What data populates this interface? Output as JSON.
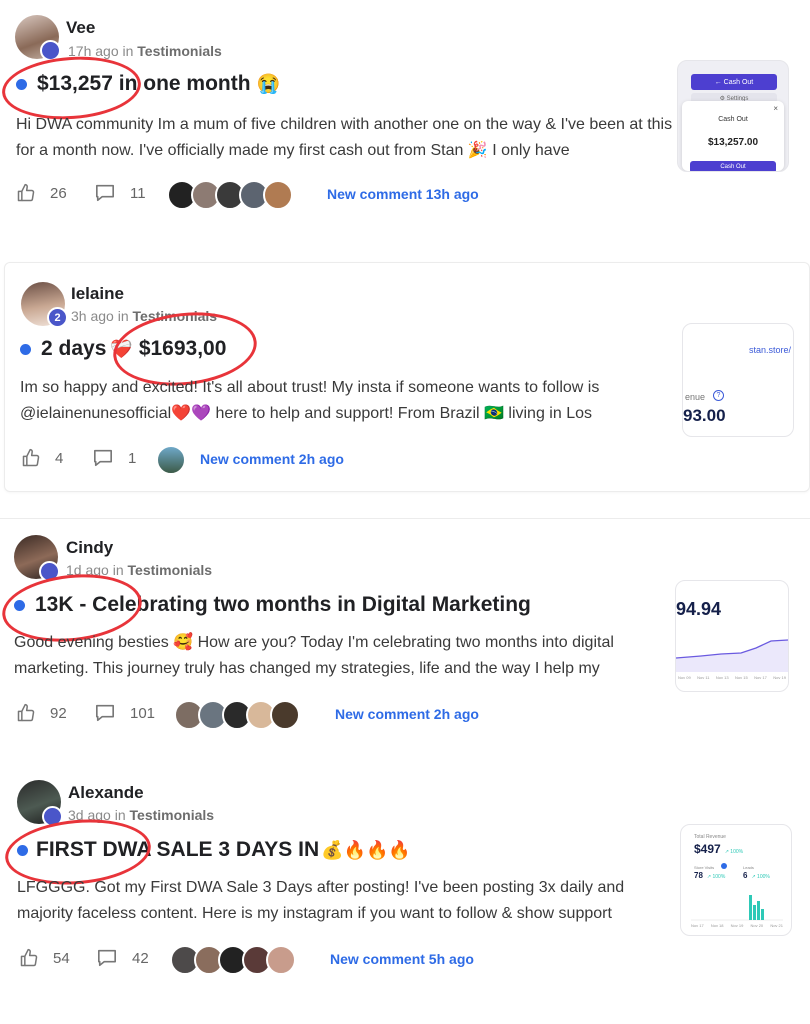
{
  "posts": [
    {
      "author": "Vee",
      "level": "",
      "time": "17h ago",
      "in_word": "in",
      "category": "Testimonials",
      "title_main": "$13,257 in one month",
      "title_emoji": "😭",
      "body": "Hi DWA community Im a mum of five children with another one on the way & I've been at this for a month now. I've officially made my first cash out from Stan 🎉 I only have",
      "likes": "26",
      "comments": "11",
      "new_comment": "New comment 13h ago",
      "preview": {
        "top_button": "← Cash Out",
        "settings": "⚙ Settings",
        "modal_title": "Cash Out",
        "amount": "$13,257.00",
        "bottom_button": "Cash Out"
      }
    },
    {
      "author": "Ielaine",
      "level": "2",
      "time": "3h ago",
      "in_word": "in",
      "category": "Testimonials",
      "title_main": "2 days",
      "title_emoji": "❤️‍🩹",
      "title_amount": "$1693,00",
      "body": "Im so happy and excited! It's all about trust! My insta if someone wants to follow is @ielainenunesofficial❤️💜 here to help and support! From Brazil 🇧🇷 living in Los",
      "likes": "4",
      "comments": "1",
      "new_comment": "New comment 2h ago",
      "preview": {
        "url": "stan.store/",
        "label": "enue",
        "value": "93.00"
      }
    },
    {
      "author": "Cindy",
      "level": "",
      "time": "1d ago",
      "in_word": "in",
      "category": "Testimonials",
      "title_main": "13K - Celebrating two months in Digital Marketing",
      "body": "Good evening besties 🥰 How are you? Today I'm celebrating two months into digital marketing. This journey truly has changed my strategies, life and the way I help my",
      "likes": "92",
      "comments": "101",
      "new_comment": "New comment 2h ago",
      "preview": {
        "value": "94.94",
        "axis_labels": [
          "Nov 09",
          "Nov 11",
          "Nov 13",
          "Nov 15",
          "Nov 17",
          "Nov 19"
        ]
      }
    },
    {
      "author": "Alexande",
      "level": "",
      "time": "3d ago",
      "in_word": "in",
      "category": "Testimonials",
      "title_main": "FIRST DWA SALE 3 DAYS IN",
      "title_emoji": "💰🔥🔥🔥",
      "body": "LFGGGG. Got my First DWA Sale 3 Days after posting! I've been posting 3x daily and majority faceless content. Here is my instagram if you want to follow & show support",
      "likes": "54",
      "comments": "42",
      "new_comment": "New comment 5h ago",
      "preview": {
        "header": "Total Revenue",
        "amount": "$497",
        "amount_change": "↗ 100%",
        "stat1_label": "Store Visits",
        "stat1_value": "78",
        "stat1_change": "↗ 100%",
        "stat2_label": "Leads",
        "stat2_value": "6",
        "stat2_change": "↗ 100%",
        "axis_labels": [
          "Nov 17",
          "Nov 18",
          "Nov 19",
          "Nov 20",
          "Nov 21"
        ]
      }
    }
  ],
  "colors": {
    "accent": "#2e6be6",
    "annotation_red": "#e8343a",
    "level_badge": "#4a56c9",
    "chart_teal": "#2ec9b7",
    "chart_purple": "#6a5ae0"
  },
  "icons": [
    "thumbs-up-icon",
    "comment-bubble-icon"
  ]
}
